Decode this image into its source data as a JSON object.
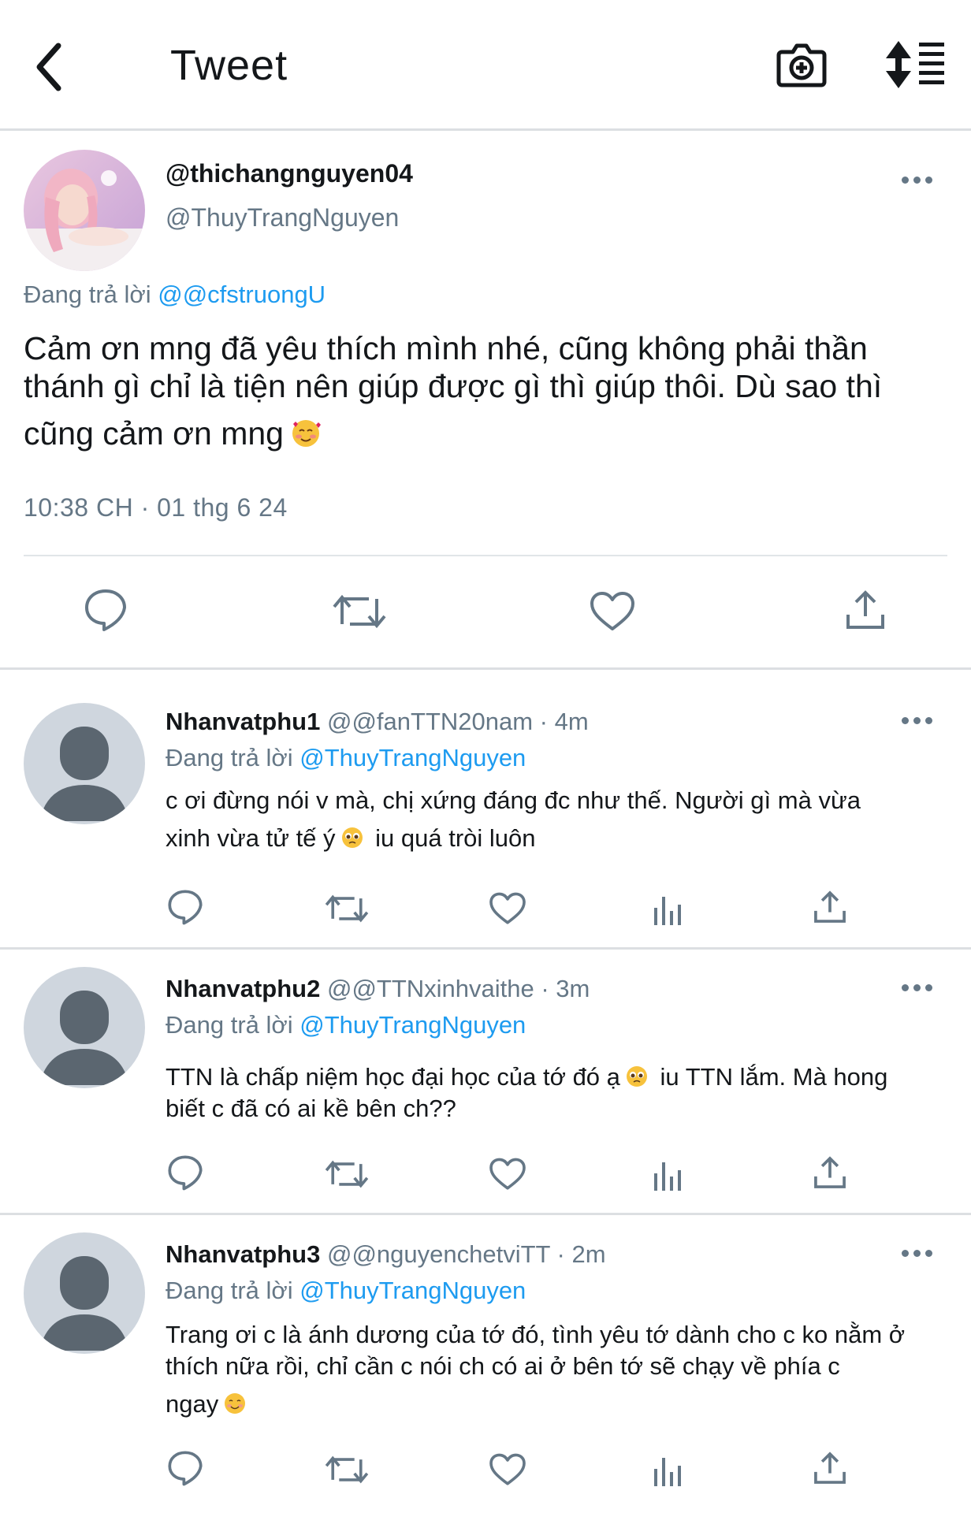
{
  "header": {
    "title": "Tweet",
    "back_icon": "chevron-left-icon",
    "camera_icon": "camera-plus-icon",
    "sort_icon": "sort-icon"
  },
  "main_tweet": {
    "display_name": "@thichangnguyen04",
    "handle": "@ThuyTrangNguyen",
    "replying_prefix": "Đang trả lời ",
    "replying_to": "@@cfstruongU",
    "text_lines": [
      "Cảm ơn mng đã yêu thích mình nhé, cũng không phải thần",
      "thánh gì chỉ là tiện nên giúp được gì thì giúp thôi. Dù sao thì",
      "cũng cảm ơn mng"
    ],
    "timestamp": "10:38 CH · 01 thg 6 24"
  },
  "replies": [
    {
      "name": "Nhanvatphu1",
      "meta": " @@fanTTN20nam · 4m",
      "replying_prefix": "Đang trả lời ",
      "replying_to": "@ThuyTrangNguyen",
      "line1": "c ơi đừng nói v mà, chị xứng đáng đc như thế. Người gì mà vừa",
      "line2_a": "xinh vừa tử tế ý",
      "line2_b": " iu quá tròi luôn"
    },
    {
      "name": "Nhanvatphu2",
      "meta": " @@TTNxinhvaithe · 3m",
      "replying_prefix": "Đang trả lời ",
      "replying_to": "@ThuyTrangNguyen",
      "line1_a": "TTN là chấp niệm học đại học của tớ đó ạ",
      "line1_b": " iu TTN lắm. Mà hong",
      "line2": "biết c đã có ai kề bên ch??"
    },
    {
      "name": "Nhanvatphu3",
      "meta": " @@nguyenchetviTT · 2m",
      "replying_prefix": "Đang trả lời ",
      "replying_to": "@ThuyTrangNguyen",
      "line1": "Trang ơi c là ánh dương của tớ đó, tình yêu tớ dành cho c ko nằm ở",
      "line2": "thích nữa rồi, chỉ cần c nói ch có ai ở bên tớ sẽ chạy về phía c",
      "line3": "ngay"
    }
  ],
  "colors": {
    "link": "#1d9bf0",
    "muted": "#657786",
    "text": "#14171a",
    "divider": "#dcdfe2",
    "avatar_placeholder": "#cfd6de",
    "avatar_figure": "#5b6670"
  }
}
